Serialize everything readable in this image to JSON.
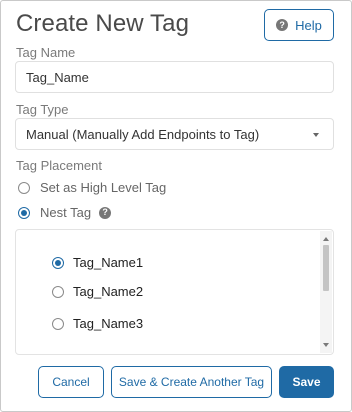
{
  "dialog": {
    "title": "Create New Tag",
    "help_label": "Help",
    "help_icon": "question-circle-icon"
  },
  "tag_name": {
    "label": "Tag Name",
    "value": "Tag_Name"
  },
  "tag_type": {
    "label": "Tag Type",
    "selected": "Manual (Manually Add Endpoints to Tag)"
  },
  "tag_placement": {
    "label": "Tag Placement",
    "options": [
      {
        "label": "Set as High Level Tag",
        "checked": false
      },
      {
        "label": "Nest Tag",
        "checked": true
      }
    ]
  },
  "nest_list": {
    "items": [
      {
        "label": "Tag_Name1",
        "checked": true
      },
      {
        "label": "Tag_Name2",
        "checked": false
      },
      {
        "label": "Tag_Name3",
        "checked": false
      }
    ]
  },
  "footer": {
    "cancel_label": "Cancel",
    "save_another_label": "Save & Create Another Tag",
    "save_label": "Save"
  },
  "colors": {
    "accent": "#1f6aa5",
    "border": "#c9c9c9",
    "label_text": "#7a7a7a"
  }
}
